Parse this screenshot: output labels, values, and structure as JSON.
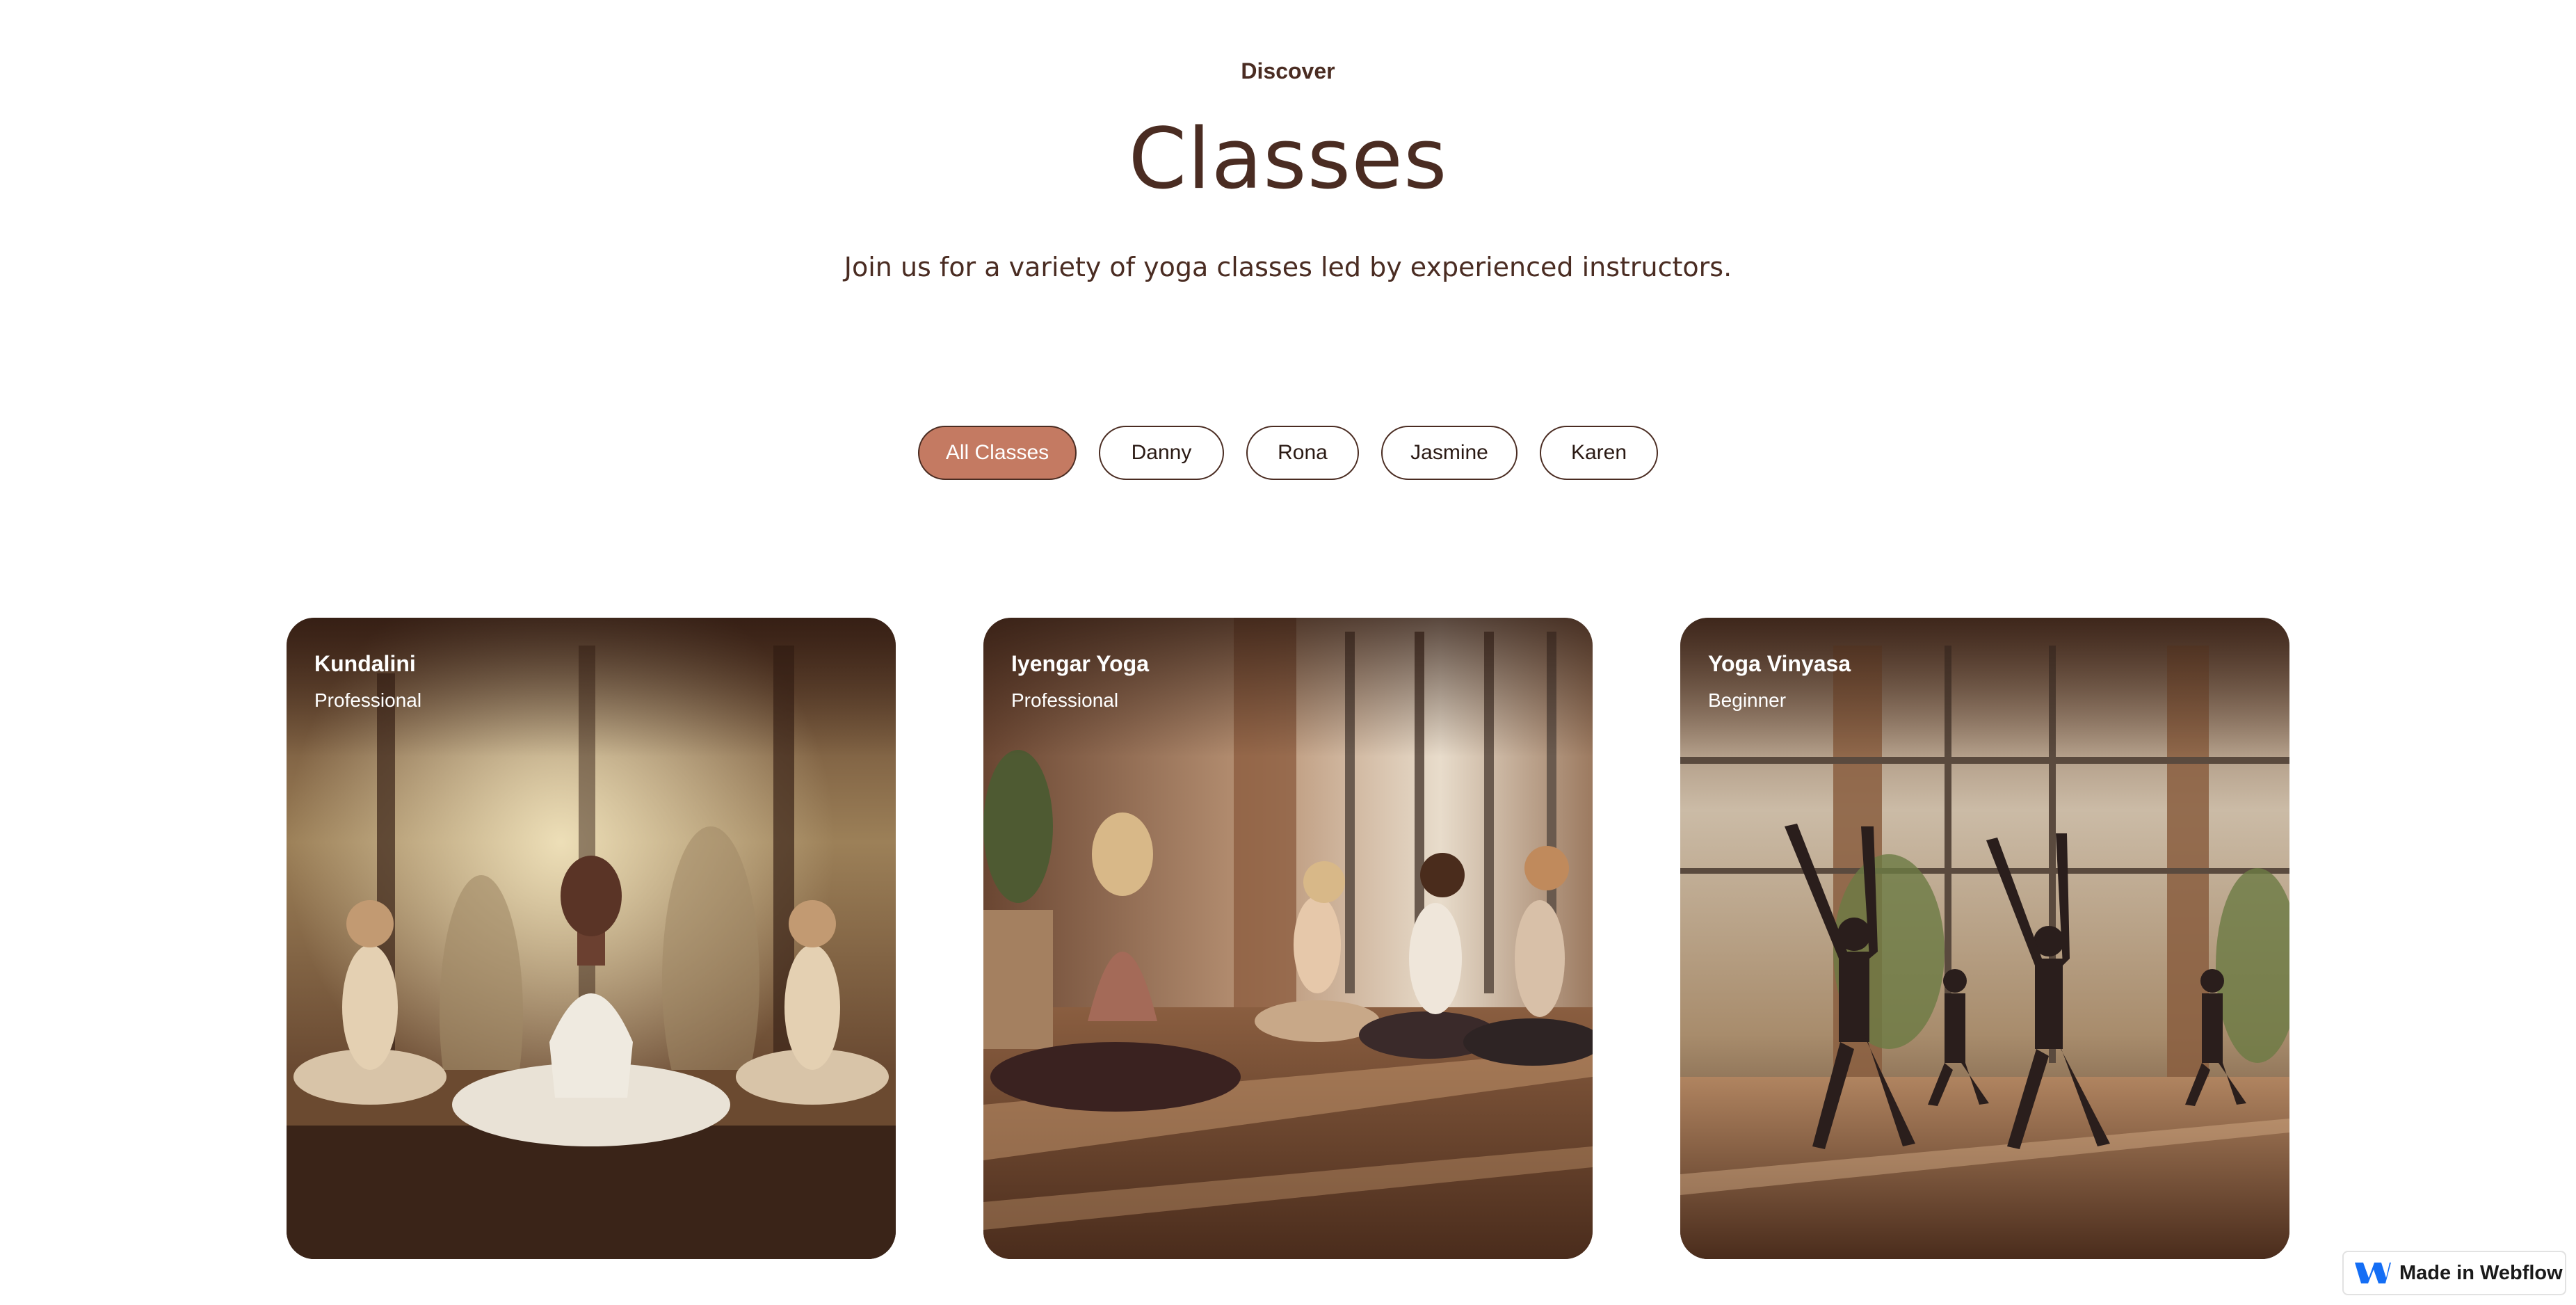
{
  "header": {
    "eyebrow": "Discover",
    "title": "Classes",
    "subtitle": "Join us for a variety of yoga classes led by experienced instructors."
  },
  "filters": [
    {
      "label": "All Classes",
      "active": true
    },
    {
      "label": "Danny",
      "active": false
    },
    {
      "label": "Rona",
      "active": false
    },
    {
      "label": "Jasmine",
      "active": false
    },
    {
      "label": "Karen",
      "active": false
    }
  ],
  "cards": [
    {
      "title": "Kundalini",
      "level": "Professional"
    },
    {
      "title": "Iyengar Yoga",
      "level": "Professional"
    },
    {
      "title": "Yoga Vinyasa",
      "level": "Beginner"
    }
  ],
  "badge": {
    "label": "Made in Webflow",
    "icon": "webflow-icon"
  },
  "colors": {
    "text": "#4a2c22",
    "accent": "#c47a62",
    "badge_logo": "#146ef5"
  }
}
